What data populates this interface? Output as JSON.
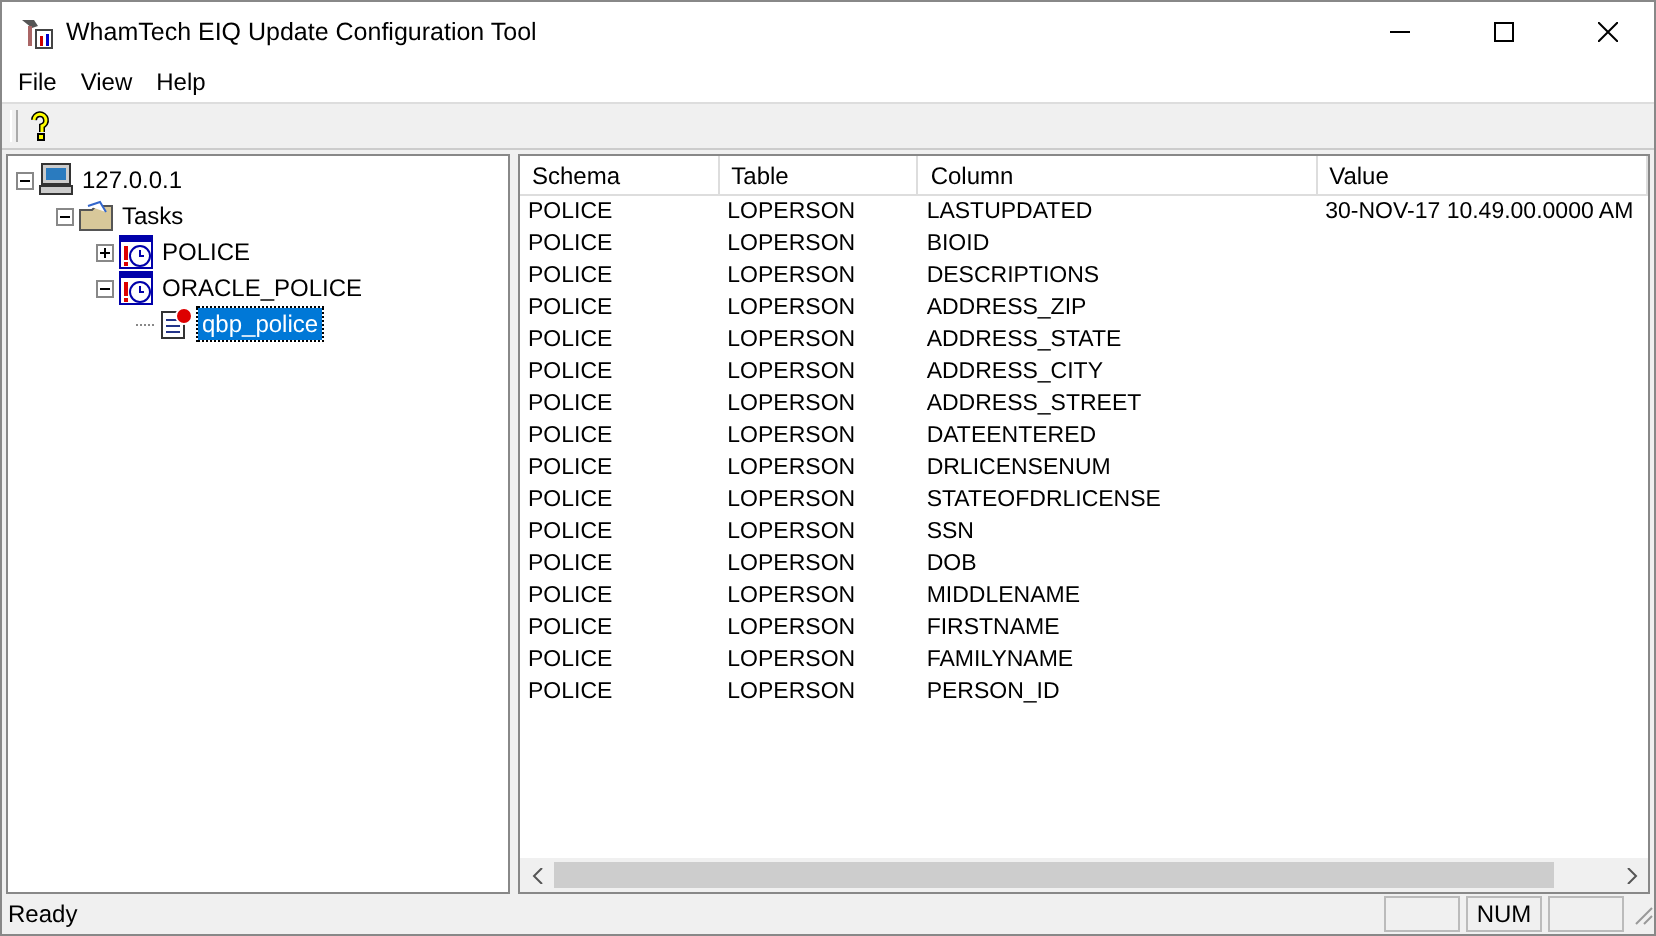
{
  "window": {
    "title": "WhamTech EIQ Update Configuration Tool"
  },
  "menu": [
    "File",
    "View",
    "Help"
  ],
  "tree": [
    {
      "label": "127.0.0.1",
      "kind": "computer",
      "expanded": true,
      "selected": false,
      "children": [
        {
          "label": "Tasks",
          "kind": "folder",
          "expanded": true,
          "selected": false,
          "children": [
            {
              "label": "POLICE",
              "kind": "task",
              "expanded": false,
              "selected": false
            },
            {
              "label": "ORACLE_POLICE",
              "kind": "task",
              "expanded": true,
              "selected": false,
              "children": [
                {
                  "label": "qbp_police",
                  "kind": "query",
                  "selected": true
                }
              ]
            }
          ]
        }
      ]
    }
  ],
  "table": {
    "columns": [
      "Schema",
      "Table",
      "Column",
      "Value"
    ],
    "rows": [
      {
        "schema": "POLICE",
        "table": "LOPERSON",
        "column": "LASTUPDATED",
        "value": "30-NOV-17 10.49.00.0000 AM"
      },
      {
        "schema": "POLICE",
        "table": "LOPERSON",
        "column": "BIOID"
      },
      {
        "schema": "POLICE",
        "table": "LOPERSON",
        "column": "DESCRIPTIONS"
      },
      {
        "schema": "POLICE",
        "table": "LOPERSON",
        "column": "ADDRESS_ZIP"
      },
      {
        "schema": "POLICE",
        "table": "LOPERSON",
        "column": "ADDRESS_STATE"
      },
      {
        "schema": "POLICE",
        "table": "LOPERSON",
        "column": "ADDRESS_CITY"
      },
      {
        "schema": "POLICE",
        "table": "LOPERSON",
        "column": "ADDRESS_STREET"
      },
      {
        "schema": "POLICE",
        "table": "LOPERSON",
        "column": "DATEENTERED"
      },
      {
        "schema": "POLICE",
        "table": "LOPERSON",
        "column": "DRLICENSENUM"
      },
      {
        "schema": "POLICE",
        "table": "LOPERSON",
        "column": "STATEOFDRLICENSE"
      },
      {
        "schema": "POLICE",
        "table": "LOPERSON",
        "column": "SSN"
      },
      {
        "schema": "POLICE",
        "table": "LOPERSON",
        "column": "DOB"
      },
      {
        "schema": "POLICE",
        "table": "LOPERSON",
        "column": "MIDDLENAME"
      },
      {
        "schema": "POLICE",
        "table": "LOPERSON",
        "column": "FIRSTNAME"
      },
      {
        "schema": "POLICE",
        "table": "LOPERSON",
        "column": "FAMILYNAME"
      },
      {
        "schema": "POLICE",
        "table": "LOPERSON",
        "column": "PERSON_ID"
      }
    ]
  },
  "status_bar": {
    "text": "Ready",
    "panels": [
      {
        "kind": "blank"
      },
      {
        "kind": "indicator",
        "text": "NUM"
      },
      {
        "kind": "blank"
      }
    ]
  }
}
